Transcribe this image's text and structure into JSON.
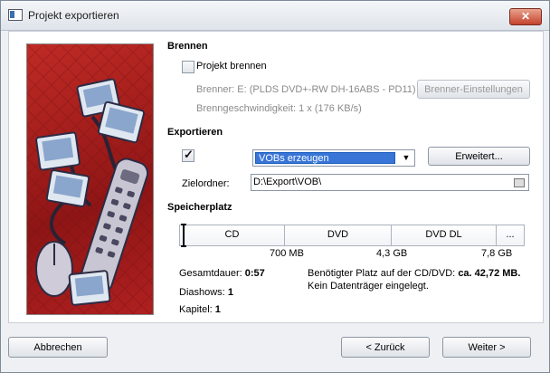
{
  "window": {
    "title": "Projekt exportieren",
    "close_glyph": "✕"
  },
  "burn": {
    "section_title": "Brennen",
    "project_burn_label": "Projekt brennen",
    "burner_text": "Brenner: E: (PLDS DVD+-RW DH-16ABS - PD11)",
    "speed_text": "Brenngeschwindigkeit: 1 x (176 KB/s)",
    "settings_button": "Brenner-Einstellungen"
  },
  "export": {
    "section_title": "Exportieren",
    "checked": true,
    "mode_value": "VOBs erzeugen",
    "advanced_button": "Erweitert...",
    "target_label": "Zielordner:",
    "target_value": "D:\\Export\\VOB\\"
  },
  "storage": {
    "section_title": "Speicherplatz",
    "segments": [
      "CD",
      "DVD",
      "DVD DL",
      "..."
    ],
    "capacities": [
      "700 MB",
      "4,3 GB",
      "7,8 GB"
    ],
    "fill_fraction": 0.0
  },
  "summary": {
    "duration_label": "Gesamtdauer:",
    "duration_value": "0:57",
    "slideshows_label": "Diashows:",
    "slideshows_value": "1",
    "chapters_label": "Kapitel:",
    "chapters_value": "1",
    "required_label": "Benötigter Platz auf der CD/DVD:",
    "required_value": "ca. 42,72 MB.",
    "no_disc": "Kein Datenträger eingelegt."
  },
  "buttons": {
    "cancel": "Abbrechen",
    "back": "< Zurück",
    "next": "Weiter >"
  },
  "icons": {
    "title": "app-window-icon",
    "close": "close-icon",
    "dropdown": "chevron-down-icon",
    "folder": "folder-icon"
  }
}
